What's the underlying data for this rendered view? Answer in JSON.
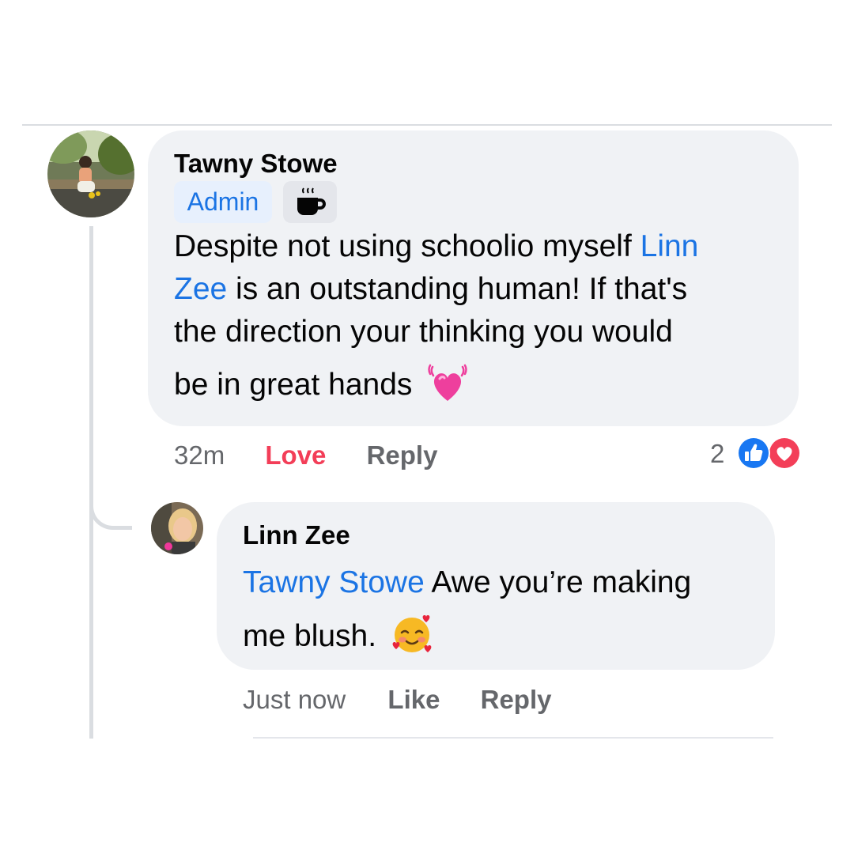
{
  "comment": {
    "author": "Tawny Stowe",
    "badge": "Admin",
    "badge_icon": "coffee-cup-icon",
    "body": {
      "line1_a": "Despite not using schoolio myself ",
      "line1_mention": "Linn",
      "line2_mention": "Zee",
      "line2_b": " is an outstanding human! If that's",
      "line3": "the direction your thinking you would",
      "line4": "be in great hands",
      "emoji": "pink-beating-heart-emoji"
    },
    "time": "32m",
    "actions": {
      "love": "Love",
      "reply": "Reply"
    },
    "reactions": {
      "count": "2",
      "types": [
        "like",
        "love"
      ]
    }
  },
  "reply": {
    "author": "Linn Zee",
    "mention": "Tawny Stowe",
    "body_a": " Awe you’re making",
    "body_b": "me blush.",
    "emoji": "smiling-face-with-hearts-emoji",
    "time": "Just now",
    "actions": {
      "like": "Like",
      "reply": "Reply"
    }
  },
  "colors": {
    "mention": "#1b74e4",
    "love_active": "#f33e58",
    "like_reaction": "#1877f2",
    "love_reaction": "#f33e58",
    "bubble": "#f0f2f5",
    "meta_text": "#65676b"
  }
}
